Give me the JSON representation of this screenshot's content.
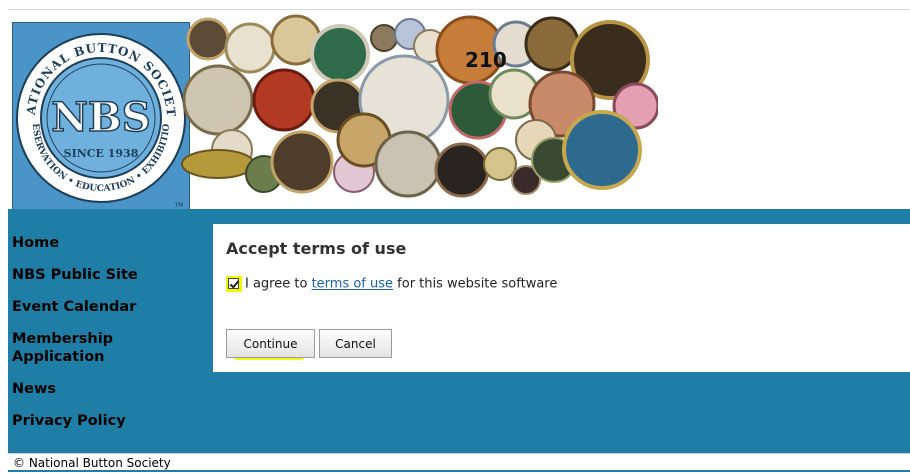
{
  "header": {
    "logo": {
      "ring_text_top": "NATIONAL BUTTON SOCIETY",
      "monogram": "NBS",
      "since": "SINCE 1938",
      "ring_text_bottom": "PRESERVATION • EDUCATION • EXHIBITIONS",
      "tm": "TM"
    },
    "banner_number": "210"
  },
  "nav": {
    "items": [
      {
        "label": "Home"
      },
      {
        "label": "NBS Public Site"
      },
      {
        "label": "Event Calendar"
      },
      {
        "label": "Membership Application"
      },
      {
        "label": "News"
      },
      {
        "label": "Privacy Policy"
      }
    ]
  },
  "panel": {
    "title": "Accept terms of use",
    "agree_prefix": "I agree to",
    "terms_link": "terms of use",
    "agree_suffix": "for this website software",
    "checkbox_checked": true,
    "continue_label": "Continue",
    "cancel_label": "Cancel"
  },
  "footer": {
    "copyright": "© National Button Society"
  },
  "colors": {
    "band": "#1f7ea5",
    "highlight": "#f4f600",
    "link": "#1a63a9"
  }
}
